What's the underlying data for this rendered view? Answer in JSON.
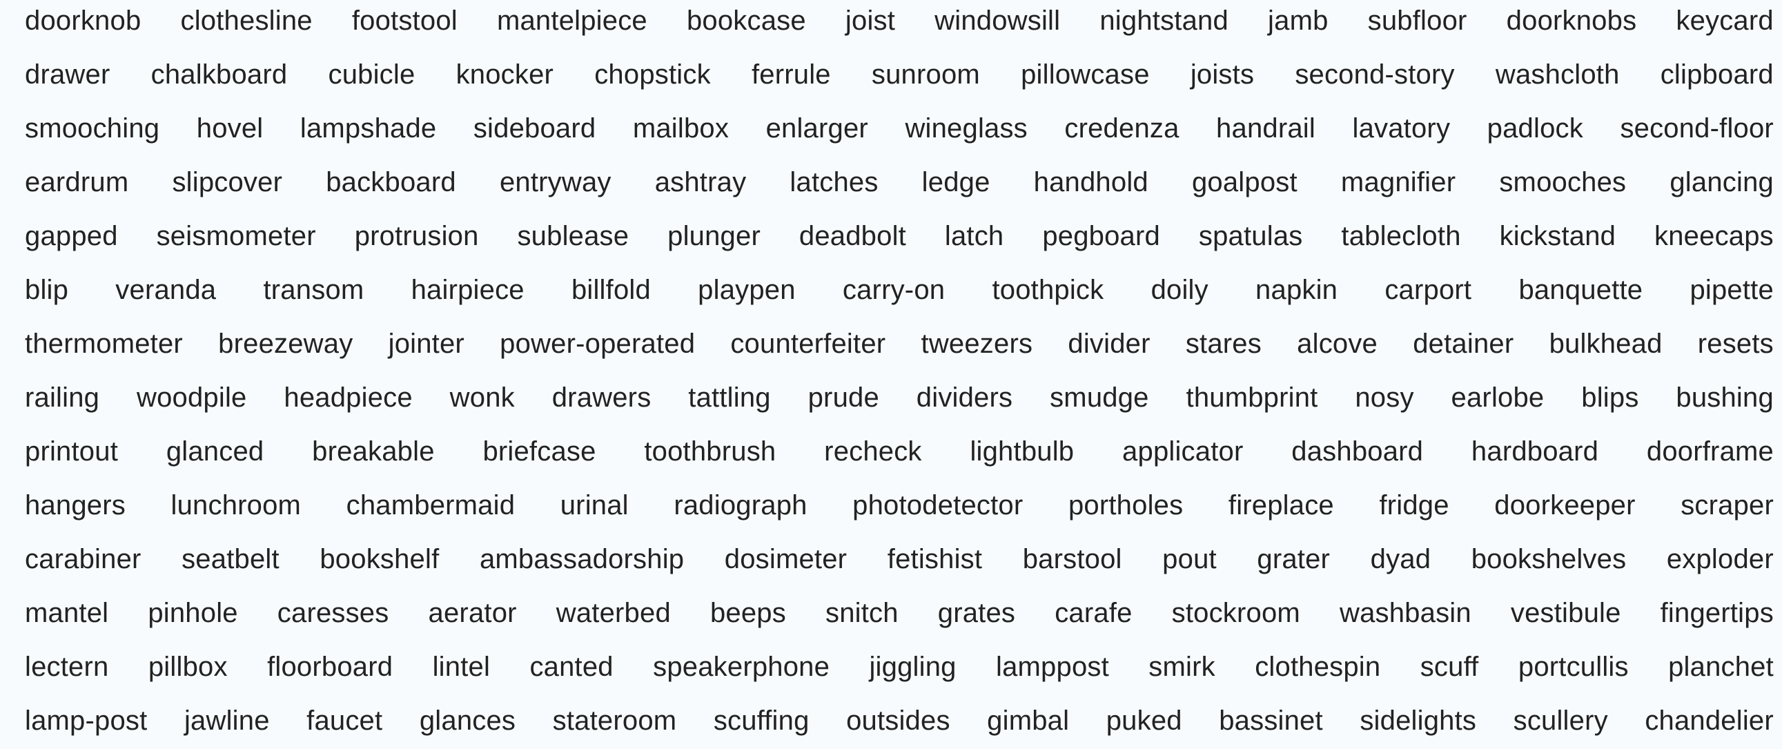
{
  "rows": [
    [
      "doorknob",
      "clothesline",
      "footstool",
      "mantelpiece",
      "bookcase",
      "joist",
      "windowsill",
      "nightstand",
      "jamb",
      "subfloor",
      "doorknobs",
      "keycard"
    ],
    [
      "drawer",
      "chalkboard",
      "cubicle",
      "knocker",
      "chopstick",
      "ferrule",
      "sunroom",
      "pillowcase",
      "joists",
      "second-story",
      "washcloth",
      "clipboard"
    ],
    [
      "smooching",
      "hovel",
      "lampshade",
      "sideboard",
      "mailbox",
      "enlarger",
      "wineglass",
      "credenza",
      "handrail",
      "lavatory",
      "padlock",
      "second-floor"
    ],
    [
      "eardrum",
      "slipcover",
      "backboard",
      "entryway",
      "ashtray",
      "latches",
      "ledge",
      "handhold",
      "goalpost",
      "magnifier",
      "smooches",
      "glancing"
    ],
    [
      "gapped",
      "seismometer",
      "protrusion",
      "sublease",
      "plunger",
      "deadbolt",
      "latch",
      "pegboard",
      "spatulas",
      "tablecloth",
      "kickstand",
      "kneecaps"
    ],
    [
      "blip",
      "veranda",
      "transom",
      "hairpiece",
      "billfold",
      "playpen",
      "carry-on",
      "toothpick",
      "doily",
      "napkin",
      "carport",
      "banquette",
      "pipette"
    ],
    [
      "thermometer",
      "breezeway",
      "jointer",
      "power-operated",
      "counterfeiter",
      "tweezers",
      "divider",
      "stares",
      "alcove",
      "detainer",
      "bulkhead",
      "resets"
    ],
    [
      "railing",
      "woodpile",
      "headpiece",
      "wonk",
      "drawers",
      "tattling",
      "prude",
      "dividers",
      "smudge",
      "thumbprint",
      "nosy",
      "earlobe",
      "blips",
      "bushing"
    ],
    [
      "printout",
      "glanced",
      "breakable",
      "briefcase",
      "toothbrush",
      "recheck",
      "lightbulb",
      "applicator",
      "dashboard",
      "hardboard",
      "doorframe"
    ],
    [
      "hangers",
      "lunchroom",
      "chambermaid",
      "urinal",
      "radiograph",
      "photodetector",
      "portholes",
      "fireplace",
      "fridge",
      "doorkeeper",
      "scraper"
    ],
    [
      "carabiner",
      "seatbelt",
      "bookshelf",
      "ambassadorship",
      "dosimeter",
      "fetishist",
      "barstool",
      "pout",
      "grater",
      "dyad",
      "bookshelves",
      "exploder"
    ],
    [
      "mantel",
      "pinhole",
      "caresses",
      "aerator",
      "waterbed",
      "beeps",
      "snitch",
      "grates",
      "carafe",
      "stockroom",
      "washbasin",
      "vestibule",
      "fingertips"
    ],
    [
      "lectern",
      "pillbox",
      "floorboard",
      "lintel",
      "canted",
      "speakerphone",
      "jiggling",
      "lamppost",
      "smirk",
      "clothespin",
      "scuff",
      "portcullis",
      "planchet"
    ],
    [
      "lamp-post",
      "jawline",
      "faucet",
      "glances",
      "stateroom",
      "scuffing",
      "outsides",
      "gimbal",
      "puked",
      "bassinet",
      "sidelights",
      "scullery",
      "chandelier"
    ]
  ]
}
